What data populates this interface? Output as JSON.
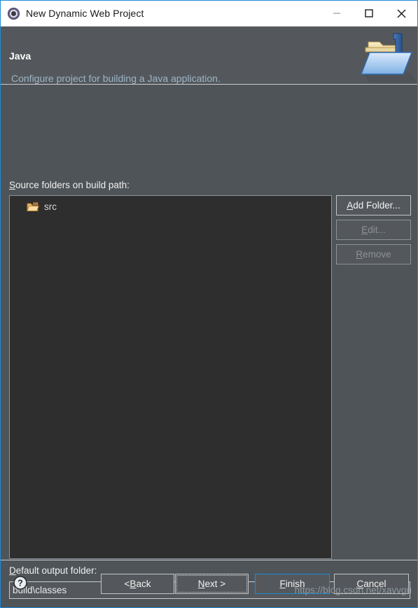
{
  "window": {
    "title": "New Dynamic Web Project",
    "icon": "eclipse-wizard-icon",
    "controls": {
      "minimize": "minimize-icon",
      "maximize": "maximize-icon",
      "close": "close-icon"
    }
  },
  "header": {
    "title": "Java",
    "subtitle": "Configure project for building a Java application.",
    "banner_icon": "java-folder-icon"
  },
  "main": {
    "source_label_mnemonic": "S",
    "source_label_rest": "ource folders on build path:",
    "source_folders": [
      {
        "name": "src",
        "icon": "source-folder-icon"
      }
    ],
    "buttons": {
      "add_folder": {
        "mnemonic": "A",
        "rest": "dd Folder...",
        "enabled": true
      },
      "edit": {
        "mnemonic": "E",
        "rest": "dit...",
        "enabled": false
      },
      "remove": {
        "mnemonic": "R",
        "rest": "emove",
        "enabled": false
      }
    },
    "output_label_mnemonic": "D",
    "output_label_rest": "efault output folder:",
    "output_value": "build\\classes",
    "output_placeholder": "build\\classes"
  },
  "footer": {
    "help": "help-icon",
    "back": {
      "prefix": "< ",
      "mnemonic": "B",
      "rest": "ack"
    },
    "next": {
      "prefix": "",
      "mnemonic": "N",
      "rest": "ext >"
    },
    "finish": {
      "prefix": "",
      "mnemonic": "F",
      "rest": "inish"
    },
    "cancel": {
      "prefix": "",
      "mnemonic": "C",
      "rest": "ancel"
    },
    "watermark": "https://blog.csdn.net/xavvgu"
  },
  "colors": {
    "dialog_bg": "#4f5458",
    "header_bg": "#54585c",
    "list_bg": "#2e2e2e",
    "accent_blue": "#1e8ad6",
    "subtitle": "#9db5c6"
  }
}
